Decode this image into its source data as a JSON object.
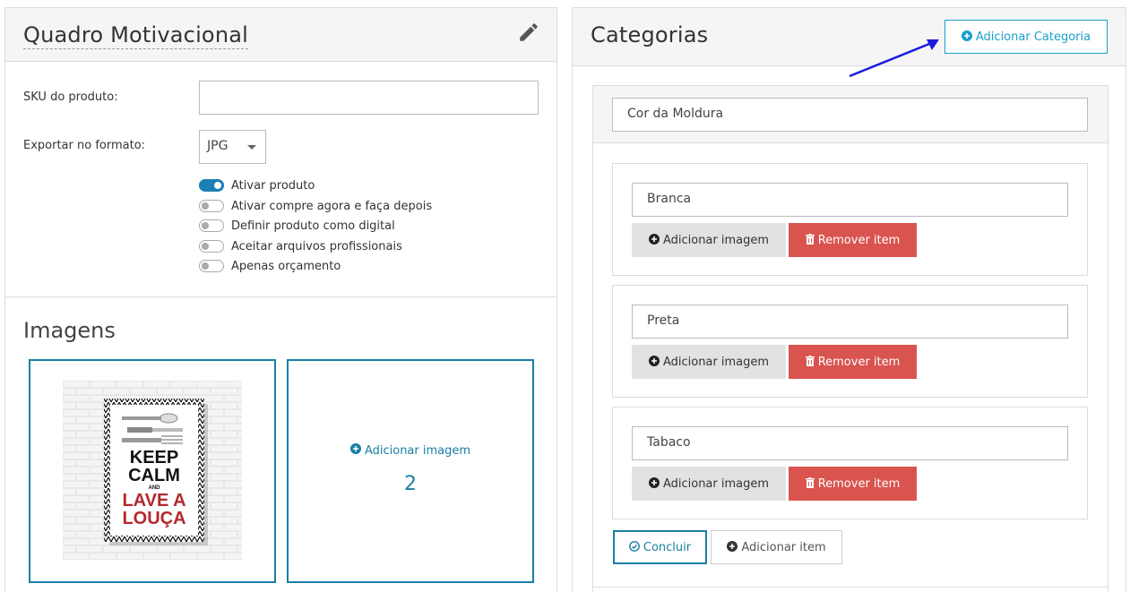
{
  "product": {
    "title": "Quadro Motivacional",
    "sku_label": "SKU do produto:",
    "sku_value": "",
    "export_label": "Exportar no formato:",
    "export_format": "JPG",
    "toggles": [
      {
        "label": "Ativar produto",
        "on": true
      },
      {
        "label": "Ativar compre agora e faça depois",
        "on": false
      },
      {
        "label": "Definir produto como digital",
        "on": false
      },
      {
        "label": "Aceitar arquivos profissionais",
        "on": false
      },
      {
        "label": "Apenas orçamento",
        "on": false
      }
    ]
  },
  "images": {
    "title": "Imagens",
    "poster": {
      "line1": "KEEP",
      "line2": "CALM",
      "line3": "AND",
      "line4": "LAVE A",
      "line5": "LOUÇA"
    },
    "add_label": "Adicionar imagem",
    "slot_number": "2"
  },
  "categories": {
    "title": "Categorias",
    "add_category_label": "Adicionar Categoria",
    "category_name": "Cor da Moldura",
    "items": [
      {
        "name": "Branca"
      },
      {
        "name": "Preta"
      },
      {
        "name": "Tabaco"
      }
    ],
    "add_image_label": "Adicionar imagem",
    "remove_item_label": "Remover item",
    "conclude_label": "Concluir",
    "add_item_label": "Adicionar item"
  },
  "colors": {
    "primary": "#1a7fa3",
    "accent": "#1a9fc9",
    "danger": "#d9534f",
    "toggle_on": "#1b7fb4",
    "arrow": "#1a1adf"
  }
}
